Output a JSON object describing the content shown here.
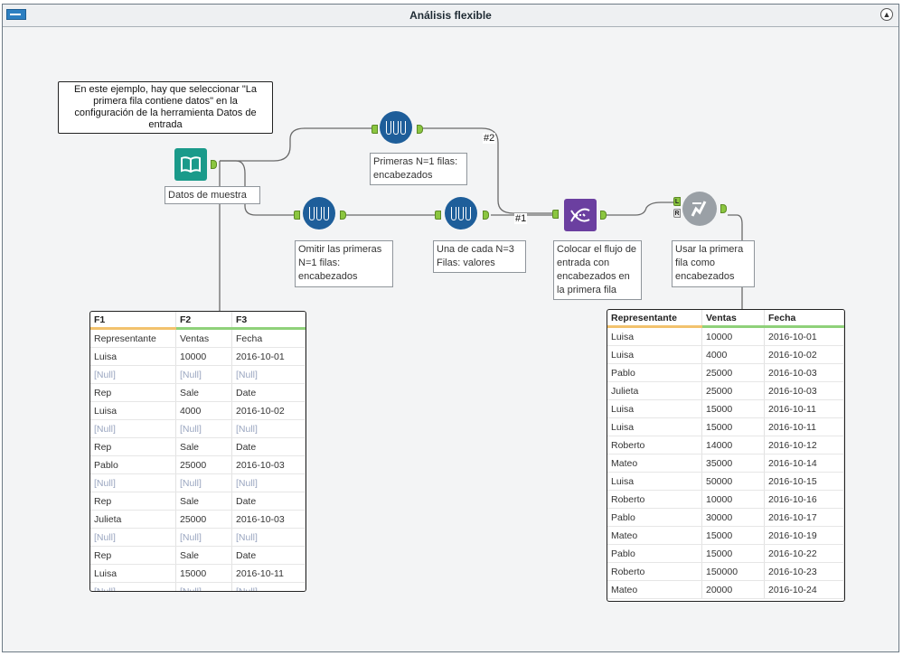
{
  "window": {
    "title": "Análisis flexible"
  },
  "comment": {
    "text": "En este ejemplo, hay que seleccionar \"La primera fila contiene datos\" en la configuración de la herramienta Datos de entrada"
  },
  "tools": {
    "input": {
      "label": "Datos de muestra",
      "icon": "book-icon"
    },
    "first_n": {
      "label": "Primeras N=1 filas: encabezados",
      "icon": "sample-icon"
    },
    "skip_n": {
      "label": "Omitir las primeras N=1 filas: encabezados",
      "icon": "sample-icon"
    },
    "every_n": {
      "label": "Una de cada N=3 Filas: valores",
      "icon": "sample-icon"
    },
    "transpose": {
      "label": "Colocar el flujo de entrada con encabezados en la primera fila",
      "icon": "dna-icon"
    },
    "dynamic_rename": {
      "label": "Usar la primera fila como encabezados",
      "icon": "rename-icon",
      "anchor_l": "L",
      "anchor_r": "R"
    }
  },
  "wire_labels": {
    "w2": "#2",
    "w1": "#1"
  },
  "colors": {
    "tool_blue": "#1e5e9a",
    "input_teal": "#1a9a8a",
    "transpose_purple": "#6b3fa0",
    "anchor_green": "#8bc640"
  },
  "left_grid": {
    "columns": [
      "F1",
      "F2",
      "F3"
    ],
    "rows": [
      [
        "Representante",
        "Ventas",
        "Fecha"
      ],
      [
        "Luisa",
        "10000",
        "2016-10-01"
      ],
      [
        "[Null]",
        "[Null]",
        "[Null]"
      ],
      [
        "Rep",
        "Sale",
        "Date"
      ],
      [
        "Luisa",
        "4000",
        "2016-10-02"
      ],
      [
        "[Null]",
        "[Null]",
        "[Null]"
      ],
      [
        "Rep",
        "Sale",
        "Date"
      ],
      [
        "Pablo",
        "25000",
        "2016-10-03"
      ],
      [
        "[Null]",
        "[Null]",
        "[Null]"
      ],
      [
        "Rep",
        "Sale",
        "Date"
      ],
      [
        "Julieta",
        "25000",
        "2016-10-03"
      ],
      [
        "[Null]",
        "[Null]",
        "[Null]"
      ],
      [
        "Rep",
        "Sale",
        "Date"
      ],
      [
        "Luisa",
        "15000",
        "2016-10-11"
      ],
      [
        "[Null]",
        "[Null]",
        "[Null]"
      ]
    ]
  },
  "right_grid": {
    "columns": [
      "Representante",
      "Ventas",
      "Fecha"
    ],
    "rows": [
      [
        "Luisa",
        "10000",
        "2016-10-01"
      ],
      [
        "Luisa",
        "4000",
        "2016-10-02"
      ],
      [
        "Pablo",
        "25000",
        "2016-10-03"
      ],
      [
        "Julieta",
        "25000",
        "2016-10-03"
      ],
      [
        "Luisa",
        "15000",
        "2016-10-11"
      ],
      [
        "Luisa",
        "15000",
        "2016-10-11"
      ],
      [
        "Roberto",
        "14000",
        "2016-10-12"
      ],
      [
        "Mateo",
        "35000",
        "2016-10-14"
      ],
      [
        "Luisa",
        "50000",
        "2016-10-15"
      ],
      [
        "Roberto",
        "10000",
        "2016-10-16"
      ],
      [
        "Pablo",
        "30000",
        "2016-10-17"
      ],
      [
        "Mateo",
        "15000",
        "2016-10-19"
      ],
      [
        "Pablo",
        "15000",
        "2016-10-22"
      ],
      [
        "Roberto",
        "150000",
        "2016-10-23"
      ],
      [
        "Mateo",
        "20000",
        "2016-10-24"
      ]
    ]
  }
}
